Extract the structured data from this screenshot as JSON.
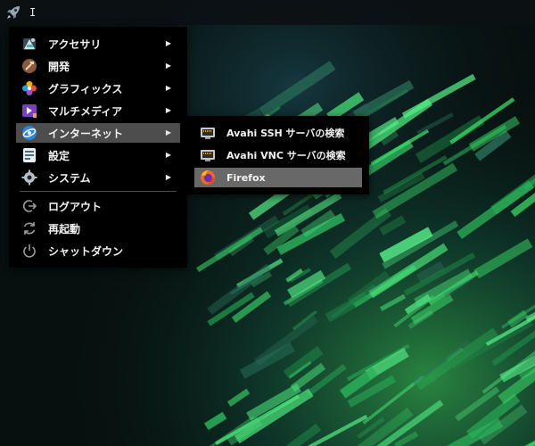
{
  "panel": {
    "launcher_icon": "rocket-icon",
    "cursor_text": "I"
  },
  "menu": {
    "items": [
      {
        "label": "アクセサリ",
        "icon": "accessories-icon",
        "has_submenu": true
      },
      {
        "label": "開発",
        "icon": "development-icon",
        "has_submenu": true
      },
      {
        "label": "グラフィックス",
        "icon": "graphics-icon",
        "has_submenu": true
      },
      {
        "label": "マルチメディア",
        "icon": "multimedia-icon",
        "has_submenu": true
      },
      {
        "label": "インターネット",
        "icon": "internet-icon",
        "has_submenu": true,
        "active": true
      },
      {
        "label": "設定",
        "icon": "settings-icon",
        "has_submenu": true
      },
      {
        "label": "システム",
        "icon": "system-icon",
        "has_submenu": true
      }
    ],
    "session": [
      {
        "label": "ログアウト",
        "icon": "logout-icon"
      },
      {
        "label": "再起動",
        "icon": "reboot-icon"
      },
      {
        "label": "シャットダウン",
        "icon": "shutdown-icon"
      }
    ],
    "arrow": "▶"
  },
  "submenu": {
    "items": [
      {
        "label": "Avahi SSH サーバの検索",
        "icon": "network-server-icon"
      },
      {
        "label": "Avahi VNC サーバの検索",
        "icon": "network-server-icon"
      },
      {
        "label": "Firefox",
        "icon": "firefox-icon",
        "active": true
      }
    ]
  },
  "colors": {
    "menu_bg": "#000000",
    "active_item": "#4d4d4d",
    "active_subitem": "#686868",
    "wallpaper_accent": "#3ddc6a"
  }
}
